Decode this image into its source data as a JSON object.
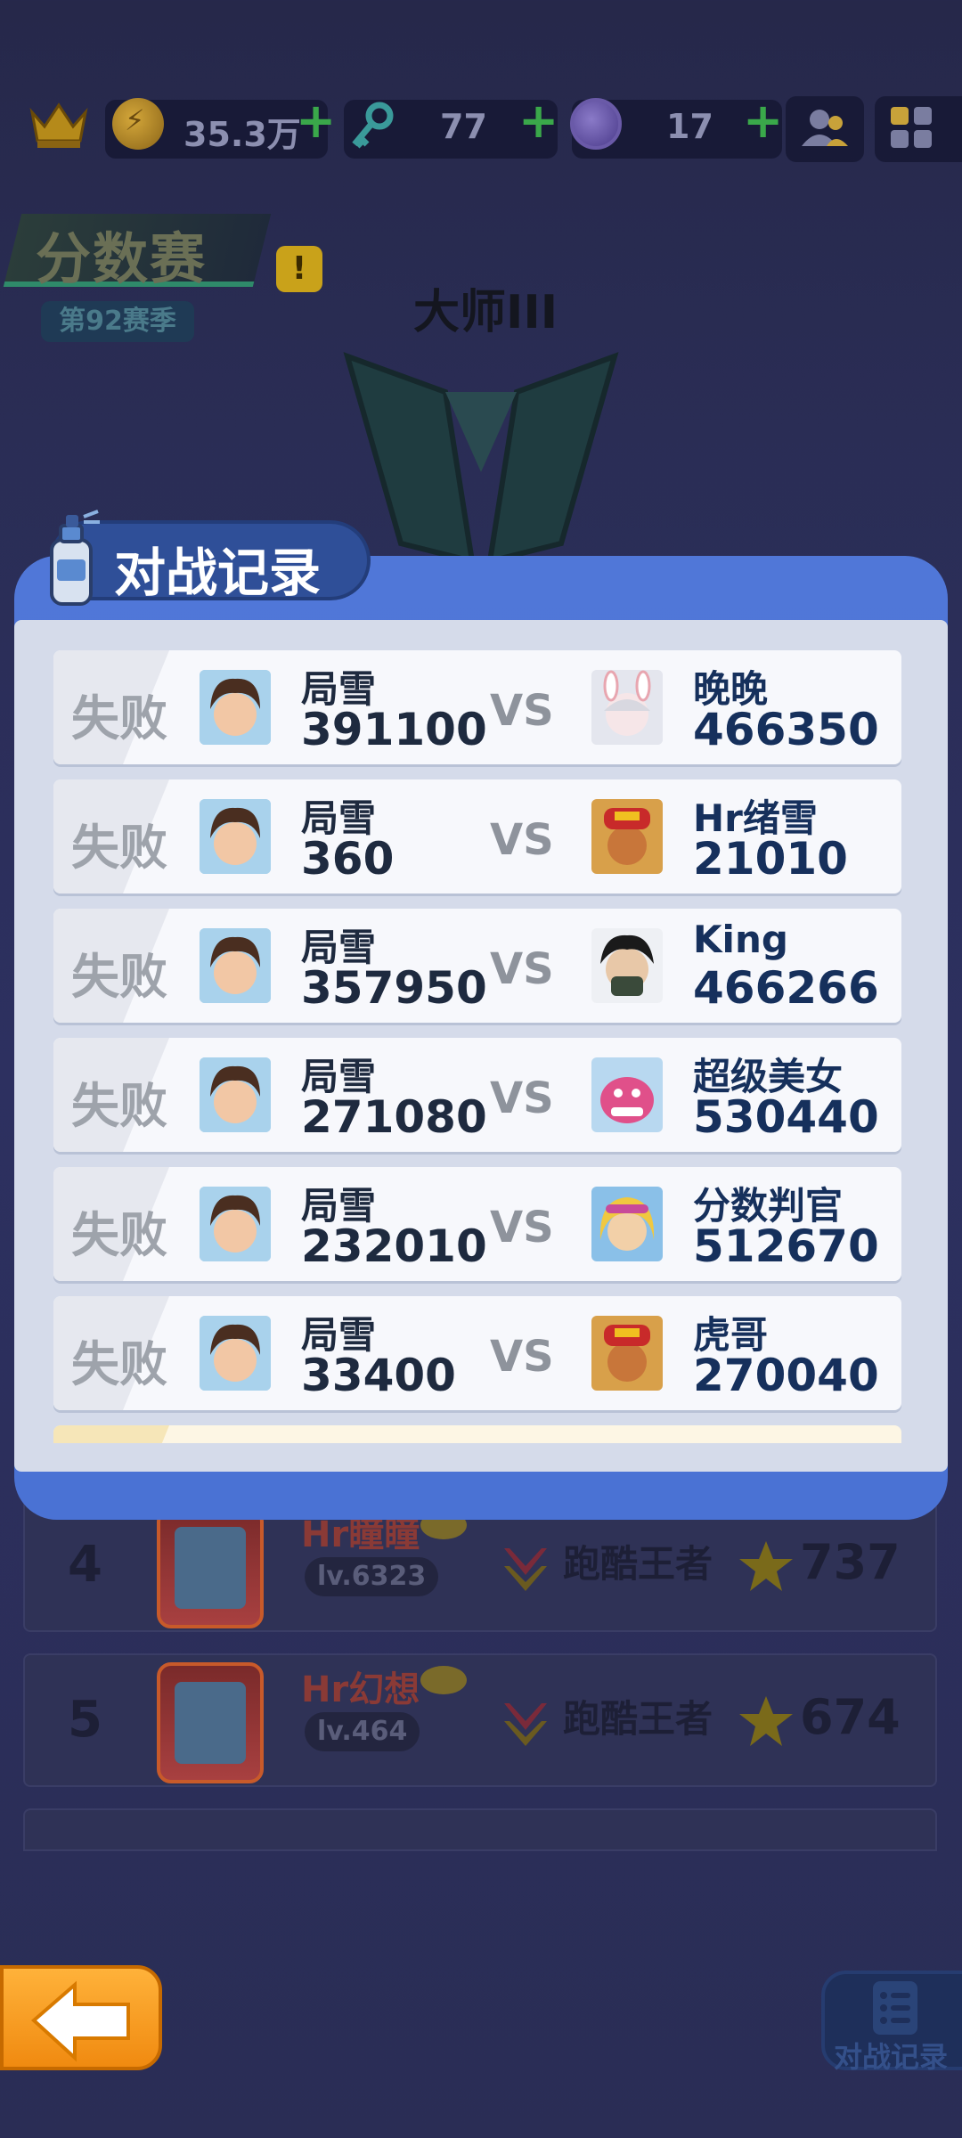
{
  "topbar": {
    "coins": "35.3万",
    "keys": "77",
    "tokens": "17"
  },
  "header": {
    "mode_title": "分数赛",
    "season": "第92赛季",
    "rank": "大师III"
  },
  "modal": {
    "title": "对战记录",
    "vs_label": "VS",
    "records": [
      {
        "result": "失败",
        "my_name": "局雪",
        "my_score": "391100",
        "opp_name": "晚晚",
        "opp_score": "466350"
      },
      {
        "result": "失败",
        "my_name": "局雪",
        "my_score": "360",
        "opp_name": "Hr绪雪",
        "opp_score": "21010"
      },
      {
        "result": "失败",
        "my_name": "局雪",
        "my_score": "357950",
        "opp_name": "King",
        "opp_score": "466266"
      },
      {
        "result": "失败",
        "my_name": "局雪",
        "my_score": "271080",
        "opp_name": "超级美女",
        "opp_score": "530440"
      },
      {
        "result": "失败",
        "my_name": "局雪",
        "my_score": "232010",
        "opp_name": "分数判官",
        "opp_score": "512670"
      },
      {
        "result": "失败",
        "my_name": "局雪",
        "my_score": "33400",
        "opp_name": "虎哥",
        "opp_score": "270040"
      }
    ]
  },
  "leaderboard": {
    "rows": [
      {
        "rank": "4",
        "name": "Hr瞳瞳",
        "level": "lv.6323",
        "title": "跑酷王者",
        "points": "737"
      },
      {
        "rank": "5",
        "name": "Hr幻想",
        "level": "lv.464",
        "title": "跑酷王者",
        "points": "674"
      }
    ]
  },
  "bottom": {
    "record_button": "对战记录"
  },
  "colors": {
    "modal_blue": "#4a72d4",
    "back_orange": "#f59a1a",
    "result_grey": "#9ea3ab"
  }
}
